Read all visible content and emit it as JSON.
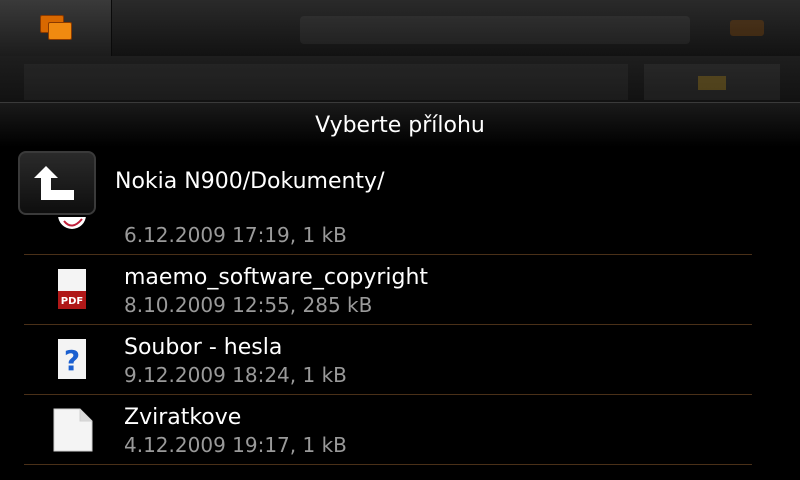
{
  "dialog": {
    "title": "Vyberte přílohu",
    "current_path": "Nokia N900/Dokumenty/",
    "up_button_icon": "folder-up-icon"
  },
  "files": [
    {
      "name": "",
      "meta": "6.12.2009 17:19, 1 kB",
      "icon": "partially-visible-file-icon"
    },
    {
      "name": "maemo_software_copyright",
      "meta": "8.10.2009 12:55, 285 kB",
      "icon": "pdf-icon",
      "icon_label": "PDF"
    },
    {
      "name": "Soubor - hesla",
      "meta": "9.12.2009 18:24, 1 kB",
      "icon": "unknown-file-icon",
      "icon_label": "?"
    },
    {
      "name": "Zviratkove",
      "meta": "4.12.2009 19:17, 1 kB",
      "icon": "text-file-icon"
    }
  ],
  "colors": {
    "accent_orange": "#f08a10",
    "separator": "#4a3018",
    "meta_text": "#9a9a9a",
    "pdf_red": "#b01818",
    "question_blue": "#1a5fd0"
  }
}
